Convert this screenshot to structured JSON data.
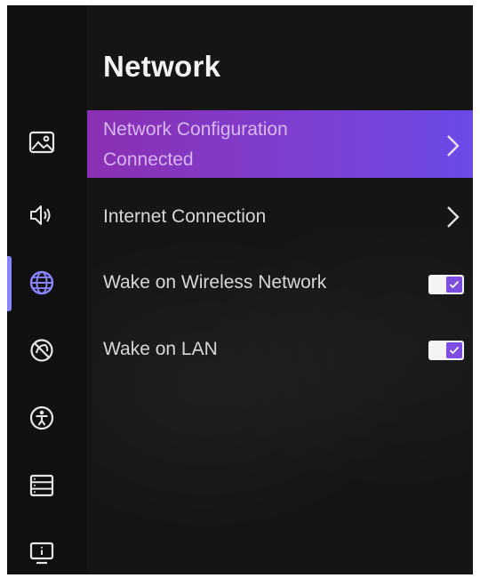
{
  "header": {
    "title": "Network"
  },
  "sidebar": {
    "items": [
      {
        "name": "picture",
        "icon": "picture-icon"
      },
      {
        "name": "sound",
        "icon": "speaker-icon"
      },
      {
        "name": "network",
        "icon": "globe-icon",
        "active": true
      },
      {
        "name": "restrictions",
        "icon": "blocked-icon"
      },
      {
        "name": "accessibility",
        "icon": "accessibility-icon"
      },
      {
        "name": "system",
        "icon": "list-icon"
      },
      {
        "name": "support",
        "icon": "info-screen-icon"
      }
    ]
  },
  "menu": {
    "items": [
      {
        "label": "Network Configuration",
        "sublabel": "Connected",
        "type": "submenu",
        "selected": true
      },
      {
        "label": "Internet Connection",
        "type": "submenu"
      },
      {
        "label": "Wake on Wireless Network",
        "type": "toggle",
        "value": true
      },
      {
        "label": "Wake on LAN",
        "type": "toggle",
        "value": true
      }
    ]
  },
  "colors": {
    "accent": "#7b4de0",
    "selected_gradient_start": "#8a2fb2",
    "selected_gradient_end": "#6b4ae8",
    "background": "#151515"
  }
}
